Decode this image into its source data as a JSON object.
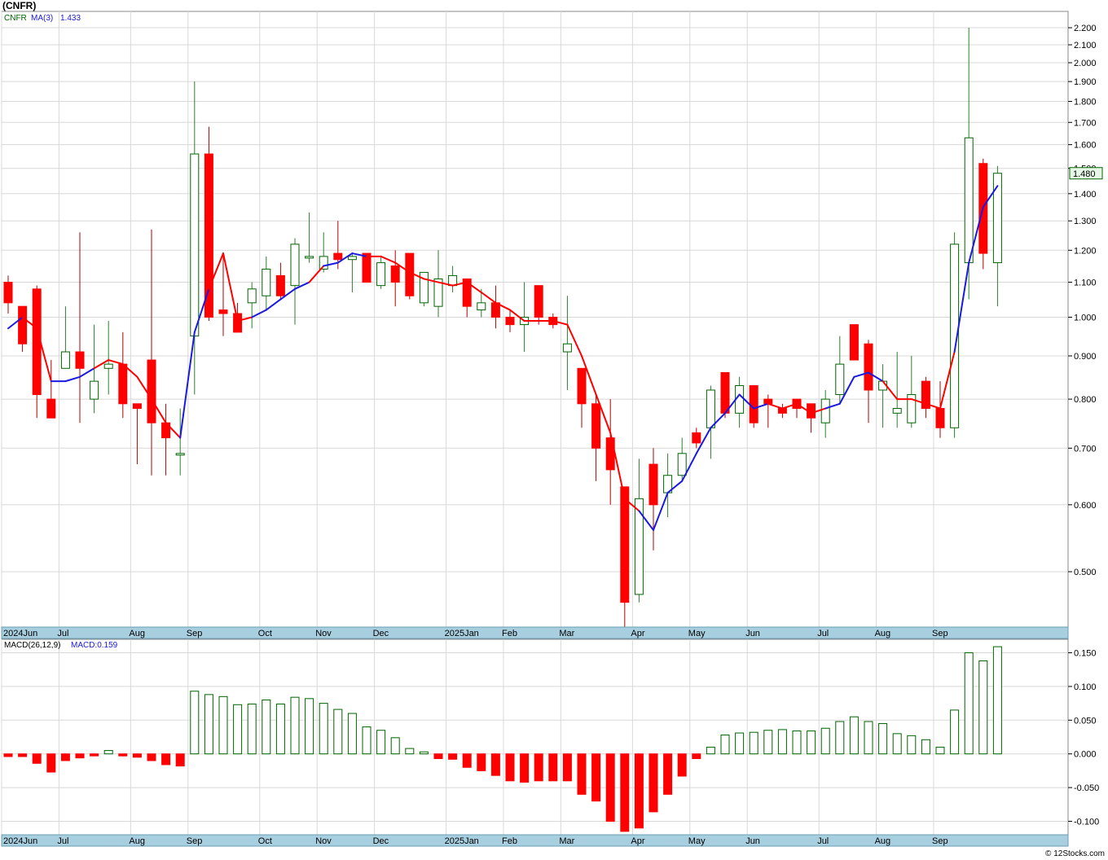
{
  "title": "(CNFR)",
  "footer": "© 12Stocks.com",
  "colors": {
    "up": "#006400",
    "down": "#ff0000",
    "grid": "#d8d8d8",
    "axis_band": "#a8cfe0",
    "ma": "#1a1ae0",
    "ma_down": "#ff0000"
  },
  "legend": {
    "symbol": "CNFR",
    "ma_label": "MA(3)",
    "ma_value": "1.433",
    "macd_label": "MACD(26,12,9)",
    "macd_value": "MACD:0.159"
  },
  "last_price_label": "1.480",
  "month_labels": [
    "2024Jun",
    "Jul",
    "Aug",
    "Sep",
    "Oct",
    "Nov",
    "Dec",
    "2025Jan",
    "Feb",
    "Mar",
    "Apr",
    "May",
    "Jun",
    "Jul",
    "Aug",
    "Sep"
  ],
  "month_start_index": [
    0,
    4,
    9,
    13,
    18,
    22,
    26,
    31,
    35,
    39,
    44,
    48,
    52,
    57,
    61,
    65
  ],
  "price_ticks": [
    "2.200",
    "2.100",
    "2.000",
    "1.900",
    "1.800",
    "1.700",
    "1.600",
    "1.500",
    "1.400",
    "1.300",
    "1.200",
    "1.100",
    "1.000",
    "0.900",
    "0.800",
    "0.700",
    "0.600",
    "0.500"
  ],
  "macd_ticks": [
    "0.150",
    "0.100",
    "0.050",
    "0.000",
    "-0.050",
    "-0.100"
  ],
  "chart_data": [
    {
      "type": "candlestick",
      "title": "(CNFR)",
      "y_scale": "log",
      "ylim": [
        0.43,
        2.3
      ],
      "x_period": "weekly",
      "candles": [
        [
          1.1,
          1.12,
          1.01,
          1.04
        ],
        [
          1.03,
          1.03,
          0.91,
          0.93
        ],
        [
          1.08,
          1.09,
          0.76,
          0.81
        ],
        [
          0.8,
          0.89,
          0.76,
          0.76
        ],
        [
          0.87,
          1.03,
          0.88,
          0.91
        ],
        [
          0.91,
          1.26,
          0.75,
          0.87
        ],
        [
          0.8,
          0.98,
          0.77,
          0.84
        ],
        [
          0.87,
          0.99,
          0.81,
          0.88
        ],
        [
          0.88,
          0.96,
          0.76,
          0.79
        ],
        [
          0.79,
          0.79,
          0.67,
          0.78
        ],
        [
          0.89,
          1.27,
          0.65,
          0.75
        ],
        [
          0.75,
          0.79,
          0.65,
          0.72
        ],
        [
          0.69,
          0.78,
          0.65,
          0.69
        ],
        [
          0.95,
          1.9,
          0.81,
          1.56
        ],
        [
          1.56,
          1.68,
          0.99,
          1.0
        ],
        [
          1.02,
          1.19,
          0.95,
          1.01
        ],
        [
          1.01,
          1.04,
          0.96,
          0.96
        ],
        [
          1.04,
          1.1,
          0.97,
          1.08
        ],
        [
          1.06,
          1.18,
          1.02,
          1.14
        ],
        [
          1.12,
          1.16,
          1.05,
          1.06
        ],
        [
          1.09,
          1.24,
          0.98,
          1.22
        ],
        [
          1.18,
          1.33,
          1.16,
          1.18
        ],
        [
          1.14,
          1.26,
          1.13,
          1.18
        ],
        [
          1.19,
          1.3,
          1.14,
          1.17
        ],
        [
          1.17,
          1.19,
          1.07,
          1.18
        ],
        [
          1.19,
          1.19,
          1.1,
          1.1
        ],
        [
          1.09,
          1.18,
          1.08,
          1.16
        ],
        [
          1.15,
          1.2,
          1.03,
          1.1
        ],
        [
          1.19,
          1.19,
          1.05,
          1.06
        ],
        [
          1.04,
          1.13,
          1.03,
          1.13
        ],
        [
          1.03,
          1.2,
          1.0,
          1.11
        ],
        [
          1.09,
          1.15,
          1.07,
          1.12
        ],
        [
          1.11,
          1.11,
          1.0,
          1.03
        ],
        [
          1.02,
          1.08,
          1.0,
          1.04
        ],
        [
          1.04,
          1.09,
          0.97,
          1.0
        ],
        [
          1.0,
          1.02,
          0.96,
          0.98
        ],
        [
          0.98,
          1.1,
          0.91,
          1.0
        ],
        [
          1.09,
          1.09,
          0.98,
          1.0
        ],
        [
          1.0,
          1.01,
          0.97,
          0.98
        ],
        [
          0.91,
          1.06,
          0.82,
          0.93
        ],
        [
          0.87,
          0.87,
          0.74,
          0.79
        ],
        [
          0.79,
          0.81,
          0.64,
          0.7
        ],
        [
          0.72,
          0.8,
          0.6,
          0.66
        ],
        [
          0.63,
          0.63,
          0.43,
          0.46
        ],
        [
          0.47,
          0.68,
          0.46,
          0.61
        ],
        [
          0.67,
          0.7,
          0.53,
          0.6
        ],
        [
          0.62,
          0.69,
          0.58,
          0.65
        ],
        [
          0.65,
          0.72,
          0.64,
          0.69
        ],
        [
          0.73,
          0.74,
          0.7,
          0.71
        ],
        [
          0.74,
          0.83,
          0.68,
          0.82
        ],
        [
          0.86,
          0.86,
          0.76,
          0.77
        ],
        [
          0.77,
          0.85,
          0.74,
          0.83
        ],
        [
          0.83,
          0.83,
          0.74,
          0.75
        ],
        [
          0.8,
          0.81,
          0.74,
          0.79
        ],
        [
          0.78,
          0.79,
          0.76,
          0.77
        ],
        [
          0.8,
          0.8,
          0.76,
          0.78
        ],
        [
          0.79,
          0.79,
          0.73,
          0.76
        ],
        [
          0.75,
          0.82,
          0.72,
          0.8
        ],
        [
          0.81,
          0.95,
          0.79,
          0.88
        ],
        [
          0.98,
          0.98,
          0.89,
          0.89
        ],
        [
          0.93,
          0.94,
          0.75,
          0.82
        ],
        [
          0.82,
          0.88,
          0.74,
          0.84
        ],
        [
          0.77,
          0.91,
          0.74,
          0.78
        ],
        [
          0.75,
          0.9,
          0.74,
          0.81
        ],
        [
          0.84,
          0.85,
          0.76,
          0.78
        ],
        [
          0.78,
          0.84,
          0.72,
          0.74
        ],
        [
          0.74,
          1.26,
          0.72,
          1.22
        ],
        [
          1.16,
          2.2,
          1.05,
          1.63
        ],
        [
          1.52,
          1.54,
          1.14,
          1.19
        ],
        [
          1.16,
          1.51,
          1.03,
          1.48
        ]
      ],
      "ma3": [
        0.97,
        1.0,
        0.97,
        0.84,
        0.84,
        0.85,
        0.87,
        0.89,
        0.88,
        0.85,
        0.8,
        0.75,
        0.72,
        0.96,
        1.08,
        1.19,
        0.99,
        1.0,
        1.02,
        1.05,
        1.08,
        1.1,
        1.15,
        1.16,
        1.19,
        1.18,
        1.18,
        1.16,
        1.13,
        1.11,
        1.1,
        1.09,
        1.1,
        1.07,
        1.04,
        1.02,
        0.99,
        0.99,
        0.99,
        0.98,
        0.9,
        0.81,
        0.73,
        0.61,
        0.59,
        0.56,
        0.62,
        0.64,
        0.69,
        0.74,
        0.77,
        0.81,
        0.78,
        0.79,
        0.78,
        0.79,
        0.77,
        0.78,
        0.79,
        0.85,
        0.86,
        0.84,
        0.8,
        0.8,
        0.79,
        0.78,
        0.91,
        1.16,
        1.35,
        1.43
      ],
      "ma3_red_segments": [
        [
          1,
          3
        ],
        [
          6,
          12
        ],
        [
          14,
          17
        ],
        [
          21,
          22
        ],
        [
          25,
          44
        ],
        [
          53,
          57
        ],
        [
          61,
          66
        ]
      ]
    },
    {
      "type": "bar",
      "title": "MACD(26,12,9)",
      "ylim": [
        -0.12,
        0.17
      ],
      "values": [
        -0.004,
        -0.004,
        -0.014,
        -0.027,
        -0.01,
        -0.006,
        -0.003,
        0.005,
        -0.003,
        -0.005,
        -0.01,
        -0.016,
        -0.018,
        0.093,
        0.088,
        0.085,
        0.073,
        0.074,
        0.08,
        0.074,
        0.084,
        0.082,
        0.075,
        0.066,
        0.06,
        0.04,
        0.035,
        0.024,
        0.008,
        0.003,
        -0.007,
        -0.008,
        -0.02,
        -0.025,
        -0.032,
        -0.04,
        -0.042,
        -0.04,
        -0.04,
        -0.04,
        -0.06,
        -0.07,
        -0.1,
        -0.115,
        -0.11,
        -0.086,
        -0.06,
        -0.033,
        -0.007,
        0.01,
        0.028,
        0.031,
        0.032,
        0.035,
        0.036,
        0.034,
        0.034,
        0.038,
        0.048,
        0.055,
        0.048,
        0.045,
        0.03,
        0.027,
        0.021,
        0.01,
        0.065,
        0.15,
        0.138,
        0.159
      ]
    }
  ]
}
